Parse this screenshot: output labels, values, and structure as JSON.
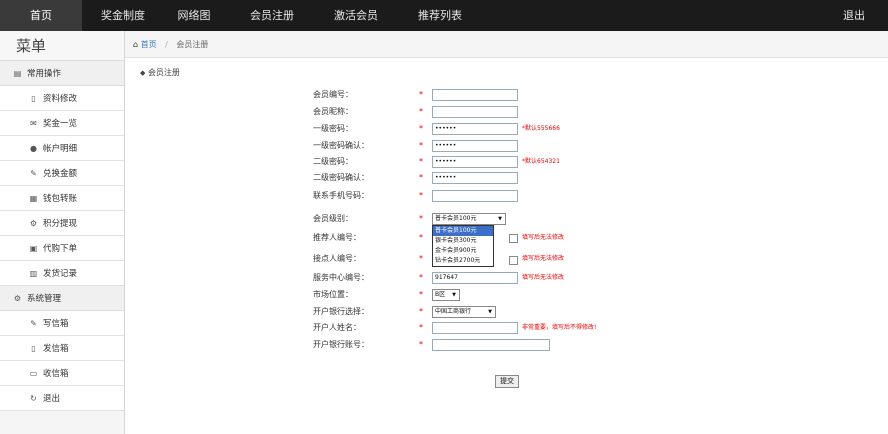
{
  "topnav": {
    "items": [
      "首页",
      "奖金制度",
      "网络图",
      "会员注册",
      "激活会员",
      "推荐列表"
    ],
    "logout": "退出"
  },
  "sidebar": {
    "title": "菜单",
    "group1": "常用操作",
    "items1": [
      "资料修改",
      "奖金一览",
      "帐户明细",
      "兑换金额",
      "钱包转账",
      "积分提现",
      "代购下单",
      "发货记录"
    ],
    "group2": "系统管理",
    "items2": [
      "写信箱",
      "发信箱",
      "收信箱",
      "退出"
    ]
  },
  "breadcrumb": {
    "home": "首页",
    "current": "会员注册"
  },
  "section_title": "会员注册",
  "form": {
    "labels": [
      "会员编号：",
      "会员昵称：",
      "一级密码：",
      "一级密码确认：",
      "二级密码：",
      "二级密码确认：",
      "联系手机号码：",
      "会员级别：",
      "推荐人编号：",
      "接点人编号：",
      "服务中心编号：",
      "市场位置：",
      "开户银行选择：",
      "开户人姓名：",
      "开户银行账号："
    ],
    "star": "*",
    "password_mask": "••••••",
    "password_hint_1": "*默认555666",
    "password_hint_2": "*默认654321",
    "level_selected": "普卡会员100元",
    "level_options": [
      "普卡会员100元",
      "银卡会员300元",
      "金卡会员900元",
      "钻卡会员2700元"
    ],
    "no_change_note": "填写后无法修改",
    "service_center_value": "917647",
    "market_position": "B区",
    "bank_selected": "中国工商银行",
    "name_note": "非常重要，填写后不得修改!",
    "submit": "提交"
  }
}
